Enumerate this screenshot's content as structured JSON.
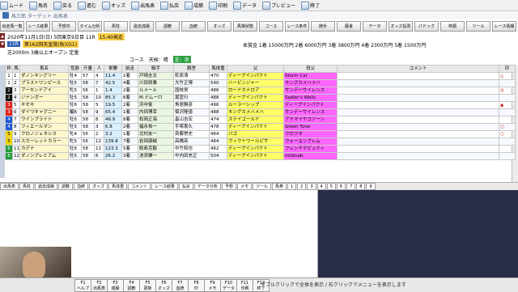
{
  "toolbar": {
    "items": [
      "ムード",
      "馬名",
      "戻る",
      "進む",
      "オッズ",
      "出馬表",
      "払戻",
      "成績",
      "印刷",
      "データ",
      "プレビュー",
      "終了"
    ]
  },
  "titlebar": {
    "title": "馬三郎 ターゲット 出馬表"
  },
  "nav": {
    "buttons": [
      "出走馬一覧",
      "レース結果",
      "予想印",
      "タイム分析",
      "馬柱",
      "過去成績",
      "調教",
      "血統",
      "オッズ",
      "馬場状態",
      "コース",
      "レース条件",
      "騎手",
      "厩舎",
      "データ",
      "オッズ投票",
      "パドック",
      "枠順",
      "ツール",
      "レース情報"
    ]
  },
  "race": {
    "date_line": "2020年11月1日(日) 5回東京9日目 11R",
    "post_time": "15:40発走",
    "race_label": "11R",
    "race_name": "第162回天皇賞(秋)(G1)",
    "conditions": "芝2000m 3歳以上オープン 定量",
    "prize_line": "本賞金 1着 15000万円 2着 6000万円 3着 3800万円 4着 2300万円 5着 1500万円",
    "course_note": "コース",
    "weather": "天候：晴",
    "track": "芝：良"
  },
  "table": {
    "headers": [
      "枠",
      "馬",
      "馬名",
      "性齢",
      "斤量",
      "人",
      "単勝",
      "前走",
      "騎手",
      "厩舎",
      "馬体重",
      "父",
      "母父",
      "コメント",
      "印"
    ],
    "rows": [
      {
        "frame": "1",
        "num": "1",
        "name": "ダノンキングリー",
        "sex_age": "牡4",
        "weight": "57",
        "pop": "4",
        "odds": "11.4",
        "prev": "1着",
        "jockey": "戸崎圭太",
        "trainer": "萩原清",
        "body": "470",
        "sire": "ディープインパクト",
        "dam_sire": "Storm Cat",
        "comment": "",
        "mark": "△"
      },
      {
        "frame": "1",
        "num": "2",
        "name": "ブラストワンピース",
        "sex_age": "牡5",
        "weight": "58",
        "pop": "7",
        "odds": "42.5",
        "prev": "4着",
        "jockey": "川田将雅",
        "trainer": "大竹正博",
        "body": "540",
        "sire": "ハービンジャー",
        "dam_sire": "キングカメハメハ",
        "comment": "",
        "mark": ""
      },
      {
        "frame": "2",
        "num": "3",
        "name": "アーモンドアイ",
        "sex_age": "牝5",
        "weight": "56",
        "pop": "1",
        "odds": "1.4",
        "prev": "2着",
        "jockey": "ルメール",
        "trainer": "国枝栄",
        "body": "486",
        "sire": "ロードカナロア",
        "dam_sire": "サンデーサイレンス",
        "comment": "",
        "mark": "◎"
      },
      {
        "frame": "2",
        "num": "4",
        "name": "ジナンボー",
        "sex_age": "牡5",
        "weight": "58",
        "pop": "10",
        "odds": "85.3",
        "prev": "6着",
        "jockey": "M.デムーロ",
        "trainer": "堀宣行",
        "body": "488",
        "sire": "ディープインパクト",
        "dam_sire": "Sadler's Wells",
        "comment": "",
        "mark": ""
      },
      {
        "frame": "3",
        "num": "5",
        "name": "キセキ",
        "sex_age": "牡6",
        "weight": "58",
        "pop": "5",
        "odds": "19.5",
        "prev": "2着",
        "jockey": "浜中俊",
        "trainer": "角居勝彦",
        "body": "496",
        "sire": "ルーラーシップ",
        "dam_sire": "ディープインパクト",
        "comment": "",
        "mark": "▲"
      },
      {
        "frame": "3",
        "num": "6",
        "name": "ダイワキャグニー",
        "sex_age": "騸6",
        "weight": "58",
        "pop": "9",
        "odds": "65.4",
        "prev": "1着",
        "jockey": "内田博幸",
        "trainer": "菊沢隆徳",
        "body": "488",
        "sire": "キングカメハメハ",
        "dam_sire": "サンデーサイレンス",
        "comment": "",
        "mark": ""
      },
      {
        "frame": "4",
        "num": "7",
        "name": "ウインブライト",
        "sex_age": "牡6",
        "weight": "58",
        "pop": "8",
        "odds": "46.9",
        "prev": "8着",
        "jockey": "松岡正海",
        "trainer": "畠山吉宏",
        "body": "474",
        "sire": "ステイゴールド",
        "dam_sire": "アドマイヤコジーン",
        "comment": "",
        "mark": ""
      },
      {
        "frame": "4",
        "num": "8",
        "name": "フィエールマン",
        "sex_age": "牡5",
        "weight": "58",
        "pop": "3",
        "odds": "6.8",
        "prev": "2着",
        "jockey": "福永祐一",
        "trainer": "手塚貴久",
        "body": "478",
        "sire": "ディープインパクト",
        "dam_sire": "Green Tune",
        "comment": "",
        "mark": "○"
      },
      {
        "frame": "5",
        "num": "9",
        "name": "クロノジェネシス",
        "sex_age": "牝4",
        "weight": "56",
        "pop": "2",
        "odds": "3.2",
        "prev": "1着",
        "jockey": "北村友一",
        "trainer": "斉藤崇史",
        "body": "464",
        "sire": "バゴ",
        "dam_sire": "クロフネ",
        "comment": "",
        "mark": "○"
      },
      {
        "frame": "5",
        "num": "10",
        "name": "スカーレットカラー",
        "sex_age": "牝5",
        "weight": "56",
        "pop": "12",
        "odds": "139.8",
        "prev": "7着",
        "jockey": "岩田康誠",
        "trainer": "高橋亮",
        "body": "464",
        "sire": "ヴィクトワールピサ",
        "dam_sire": "ウォーエンブレム",
        "comment": "",
        "mark": ""
      },
      {
        "frame": "6",
        "num": "11",
        "name": "カデナ",
        "sex_age": "牡6",
        "weight": "58",
        "pop": "11",
        "odds": "123.3",
        "prev": "5着",
        "jockey": "鮫島克駿",
        "trainer": "中竹和也",
        "body": "462",
        "sire": "ディープインパクト",
        "dam_sire": "フレンチデピュティ",
        "comment": "",
        "mark": ""
      },
      {
        "frame": "6",
        "num": "12",
        "name": "ダノンプレミアム",
        "sex_age": "牡5",
        "weight": "58",
        "pop": "6",
        "odds": "26.2",
        "prev": "3着",
        "jockey": "池添謙一",
        "trainer": "中内田充正",
        "body": "504",
        "sire": "ディープインパクト",
        "dam_sire": "Intikhab",
        "comment": "",
        "mark": ""
      }
    ]
  },
  "frame_colors": {
    "1": "#ffffff",
    "2": "#111111",
    "3": "#e2231a",
    "4": "#1e5bd8",
    "5": "#f2d600",
    "6": "#1e9d3a",
    "7": "#f08a00",
    "8": "#f06fb0"
  },
  "tabs": {
    "items": [
      "出馬表",
      "馬柱",
      "過去成績",
      "調教",
      "血統",
      "オッズ",
      "馬体重",
      "コメント",
      "レース結果",
      "払戻",
      "データ分析",
      "予想",
      "メモ",
      "ツール",
      "馬券",
      "1",
      "2",
      "3",
      "4",
      "5",
      "6",
      "7",
      "8",
      "9"
    ]
  },
  "fkeys": {
    "items": [
      {
        "key": "F1",
        "label": "ヘルプ"
      },
      {
        "key": "F2",
        "label": "出馬表"
      },
      {
        "key": "F3",
        "label": "成績"
      },
      {
        "key": "F4",
        "label": "調教"
      },
      {
        "key": "F5",
        "label": "更新"
      },
      {
        "key": "F6",
        "label": "オッズ"
      },
      {
        "key": "F7",
        "label": "血統"
      },
      {
        "key": "F8",
        "label": "印"
      },
      {
        "key": "F9",
        "label": "メモ"
      },
      {
        "key": "F10",
        "label": "データ"
      },
      {
        "key": "F11",
        "label": "印刷"
      },
      {
        "key": "F12",
        "label": "終了"
      }
    ]
  },
  "status": {
    "message": "ダブルクリックで全体を表示 / 右クリックでメニューを表示します"
  }
}
